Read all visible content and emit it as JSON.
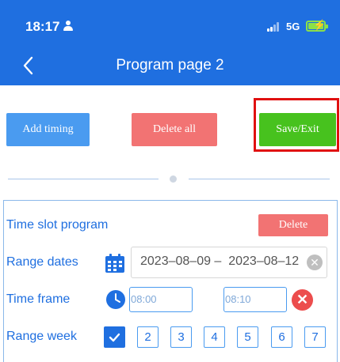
{
  "status_bar": {
    "time": "18:17",
    "network": "5G"
  },
  "header": {
    "title": "Program page 2"
  },
  "toolbar": {
    "add_timing_label": "Add timing",
    "delete_all_label": "Delete all",
    "save_exit_label": "Save/Exit"
  },
  "slot": {
    "title": "Time slot program",
    "delete_label": "Delete",
    "range_dates_label": "Range dates",
    "date_range": "2023–08–09 –  2023–08–12",
    "time_frame_label": "Time frame",
    "time_start": "08:00",
    "time_end": "08:10",
    "range_week_label": "Range week",
    "week_days": [
      "2",
      "3",
      "4",
      "5",
      "6",
      "7"
    ]
  },
  "colors": {
    "header_blue": "#1f6fe0",
    "add_button": "#4a9bf0",
    "delete_button": "#f27373",
    "save_button": "#47c21e",
    "highlight_border": "#e01010",
    "battery": "#8be04a"
  },
  "icons": [
    "person-icon",
    "signal-icon",
    "battery-icon",
    "back-icon",
    "calendar-icon",
    "clear-icon",
    "clock-icon",
    "remove-icon",
    "check-icon"
  ]
}
